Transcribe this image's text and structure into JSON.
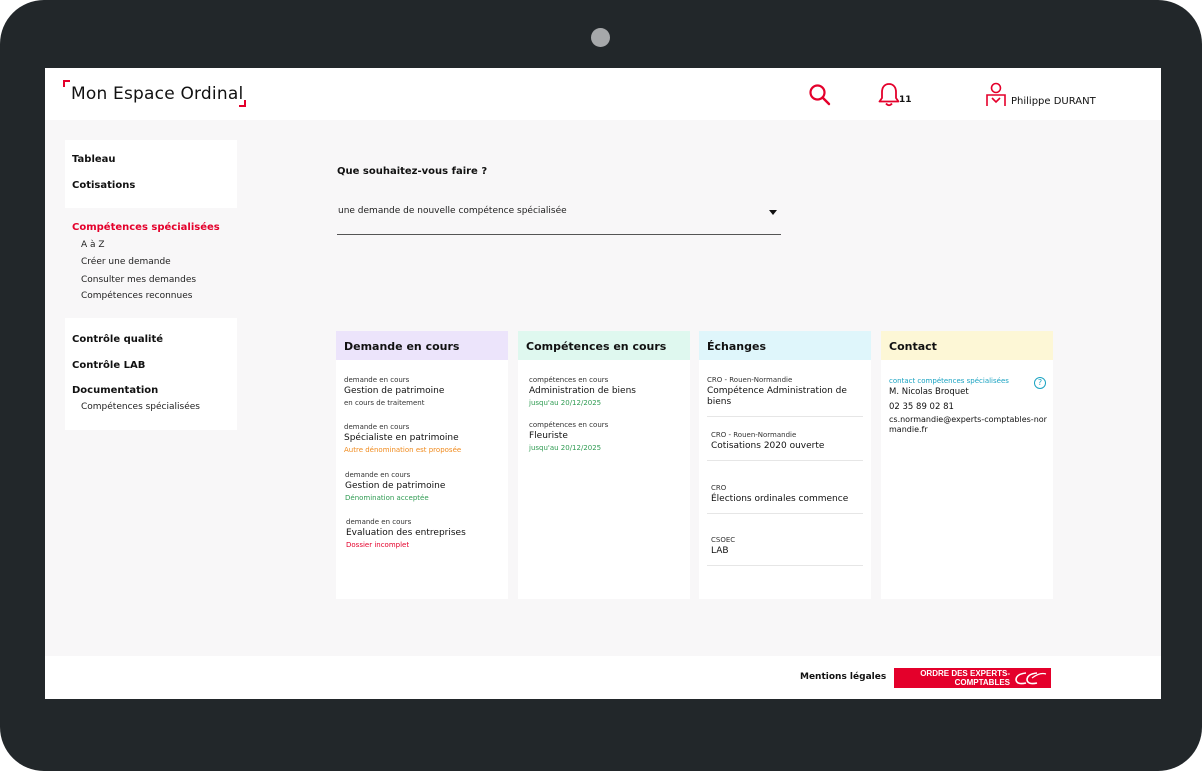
{
  "header": {
    "logo_text": "Mon Espace Ordinal",
    "notifications_count": "11",
    "user_name": "Philippe DURANT"
  },
  "sidebar": {
    "items": [
      {
        "label": "Tableau"
      },
      {
        "label": "Cotisations"
      },
      {
        "label": "Compétences spécialisées",
        "active": true
      },
      {
        "label": "Contrôle qualité"
      },
      {
        "label": "Contrôle LAB"
      },
      {
        "label": "Documentation"
      }
    ],
    "competences_sub": [
      "A à Z",
      "Créer une demande",
      "Consulter mes demandes",
      "Compétences reconnues"
    ],
    "documentation_sub": [
      "Compétences spécialisées"
    ]
  },
  "main": {
    "question": "Que souhaitez-vous faire ?",
    "select_value": "une demande de nouvelle compétence spécialisée"
  },
  "cards": {
    "demandes": {
      "title": "Demande en cours",
      "entries": [
        {
          "tag": "demande en cours",
          "title": "Gestion de patrimoine",
          "status": "en cours de traitement"
        },
        {
          "tag": "demande en cours",
          "title": "Spécialiste en patrimoine",
          "status": "Autre dénomination est proposée"
        },
        {
          "tag": "demande en cours",
          "title": "Gestion de patrimoine",
          "status": "Dénomination acceptée"
        },
        {
          "tag": "demande en cours",
          "title": "Evaluation des entreprises",
          "status": "Dossier incomplet"
        }
      ]
    },
    "competences": {
      "title": "Compétences en cours",
      "entries": [
        {
          "tag": "compétences en cours",
          "title": "Administration de biens",
          "status": "jusqu'au 20/12/2025"
        },
        {
          "tag": "compétences en cours",
          "title": "Fleuriste",
          "status": "jusqu'au 20/12/2025"
        }
      ]
    },
    "echanges": {
      "title": "Échanges",
      "entries": [
        {
          "tag": "CRO - Rouen-Normandie",
          "title": "Compétence Administration de biens"
        },
        {
          "tag": "CRO - Rouen-Normandie",
          "title": "Cotisations 2020 ouverte"
        },
        {
          "tag": "CRO",
          "title": "Élections ordinales commence"
        },
        {
          "tag": "CSOEC",
          "title": "LAB"
        }
      ]
    },
    "contact": {
      "title": "Contact",
      "tag": "contact compétences spécialisées",
      "help_label": "?",
      "name": "M. Nicolas Broquet",
      "phone": "02 35 89 02 81",
      "email": "cs.normandie@experts-comptables-normandie.fr"
    }
  },
  "footer": {
    "legal": "Mentions légales",
    "org_logo_text": "ORDRE DES EXPERTS-COMPTABLES"
  },
  "colors": {
    "accent": "#e4002b",
    "demande_header": "#ece4fb",
    "competences_header": "#dff8ef",
    "echanges_header": "#dff6fb",
    "contact_header": "#fdf7d6",
    "status_orange": "#f08a1c",
    "status_green": "#2f9b52",
    "contact_cyan": "#1aa3c2"
  },
  "icons": [
    "search-icon",
    "bell-icon",
    "user-icon",
    "caret-down-icon",
    "help-icon"
  ]
}
